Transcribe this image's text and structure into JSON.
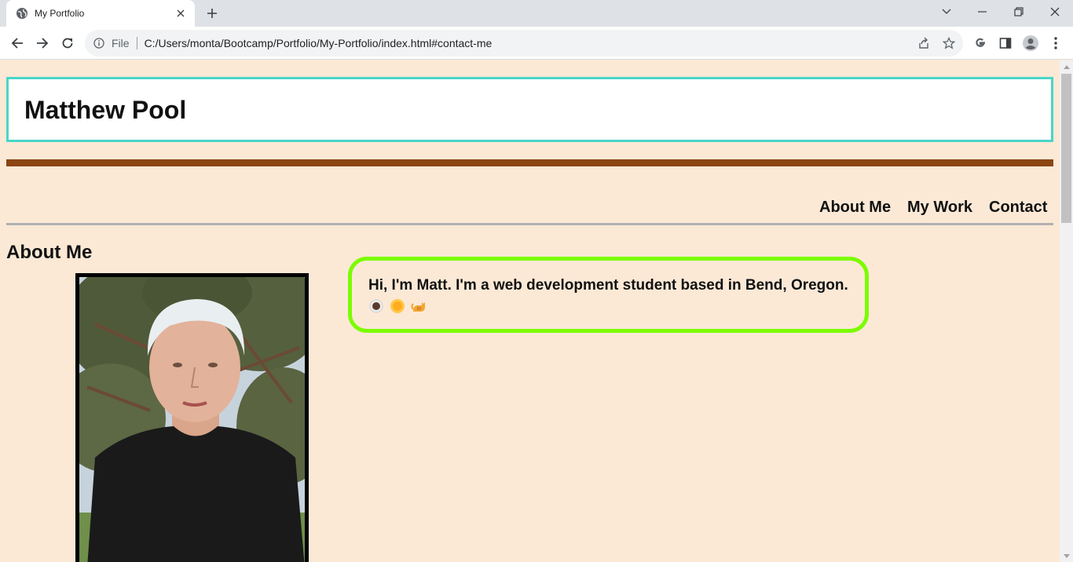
{
  "browser": {
    "tab_title": "My Portfolio",
    "file_label": "File",
    "url": "C:/Users/monta/Bootcamp/Portfolio/My-Portfolio/index.html#contact-me"
  },
  "page": {
    "site_title": "Matthew Pool",
    "nav": [
      {
        "label": "About Me"
      },
      {
        "label": "My Work"
      },
      {
        "label": "Contact"
      }
    ],
    "about": {
      "heading": "About Me",
      "bio": "Hi, I'm Matt. I'm a web development student based in Bend, Oregon.",
      "emojis": [
        "coffee-icon",
        "sun-icon",
        "cat-icon"
      ]
    }
  },
  "colors": {
    "page_bg": "#fbe9d6",
    "header_border": "#48d6c9",
    "bar": "#8b4513",
    "bio_border": "#7cfc00"
  }
}
